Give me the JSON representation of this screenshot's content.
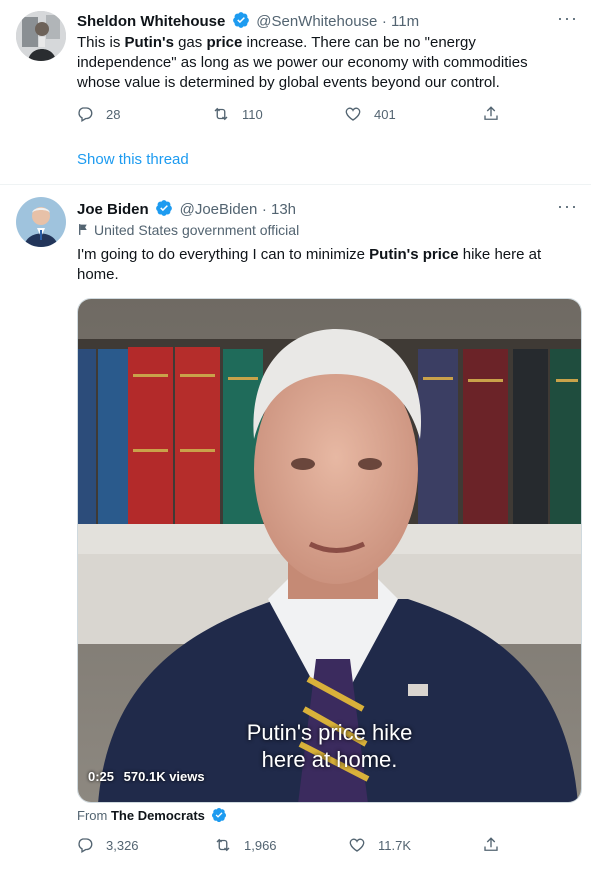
{
  "tweet1": {
    "name": "Sheldon Whitehouse",
    "handle": "@SenWhitehouse",
    "time": "· 11m",
    "text_parts": [
      "This is ",
      "Putin's",
      " gas ",
      "price",
      " increase. There can be no \"energy independence\" as long as we power our economy with commodities whose value is determined by global events beyond our control."
    ],
    "replies": "28",
    "retweets": "110",
    "likes": "401",
    "show_thread": "Show this thread"
  },
  "tweet2": {
    "name": "Joe Biden",
    "handle": "@JoeBiden",
    "time": "· 13h",
    "label": "United States government official",
    "text_parts": [
      "I'm going to do everything I can to minimize ",
      "Putin's price",
      " hike here at home."
    ],
    "video": {
      "caption_line1": "Putin's price hike",
      "caption_line2": "here at home.",
      "duration": "0:25",
      "views": "570.1K views"
    },
    "from_prefix": "From",
    "from_account": "The Democrats",
    "replies": "3,326",
    "retweets": "1,966",
    "likes": "11.7K"
  },
  "colors": {
    "accent": "#1d9bf0",
    "secondary_text": "#536471",
    "border": "#eff3f4"
  }
}
